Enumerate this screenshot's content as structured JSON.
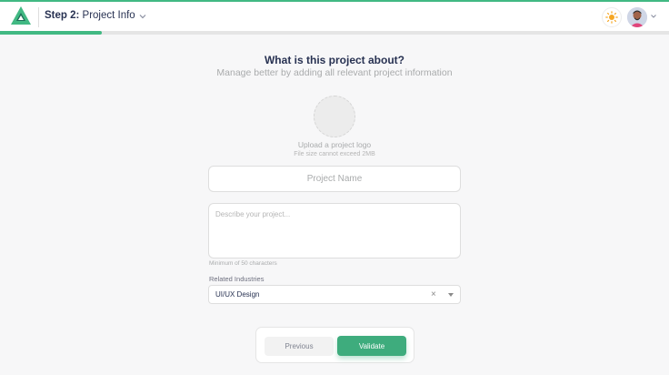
{
  "header": {
    "step_prefix": "Step 2:",
    "step_name": " Project Info",
    "progress_fraction": 0.152,
    "accent_color": "#41b983",
    "icons": [
      "logo-icon",
      "chevron-down-icon",
      "sun-icon",
      "avatar",
      "chevron-down-icon"
    ]
  },
  "main": {
    "heading": "What is this project about?",
    "subheading": "Manage better by adding all relevant project information",
    "upload_label": "Upload a project logo",
    "upload_hint": "File size cannot exceed 2MB",
    "name_placeholder": "Project Name",
    "description_placeholder": "Describe your project...",
    "min_chars_hint": "Minimum of 50 characters",
    "industries_label": "Related Industries",
    "industries_value": "UI/UX Design",
    "clear_glyph": "×"
  },
  "footer": {
    "previous_label": "Previous",
    "validate_label": "Validate"
  }
}
